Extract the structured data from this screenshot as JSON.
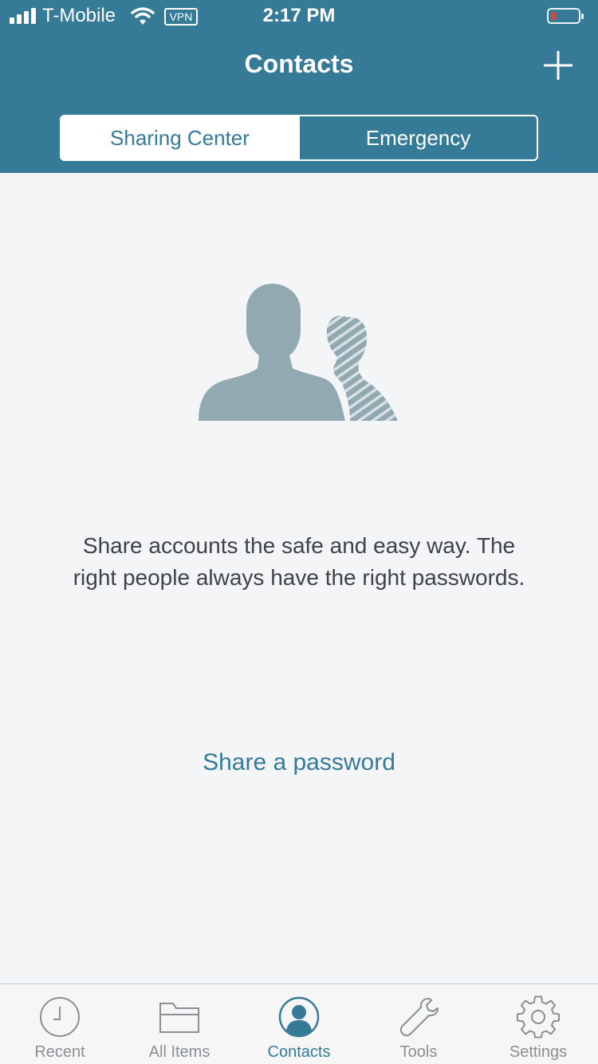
{
  "status_bar": {
    "carrier": "T-Mobile",
    "vpn": "VPN",
    "time": "2:17 PM",
    "battery_level": 0.15
  },
  "nav": {
    "title": "Contacts",
    "add_icon": "plus-icon"
  },
  "segments": [
    {
      "label": "Sharing Center",
      "selected": true
    },
    {
      "label": "Emergency",
      "selected": false
    }
  ],
  "empty_state": {
    "illustration": "people-silhouette-icon",
    "message": "Share accounts the safe and easy way. The right people always have the right passwords.",
    "action_label": "Share a password"
  },
  "tabbar": {
    "items": [
      {
        "label": "Recent",
        "icon": "clock-icon",
        "active": false
      },
      {
        "label": "All Items",
        "icon": "folder-icon",
        "active": false
      },
      {
        "label": "Contacts",
        "icon": "person-circle-icon",
        "active": true
      },
      {
        "label": "Tools",
        "icon": "wrench-icon",
        "active": false
      },
      {
        "label": "Settings",
        "icon": "gear-icon",
        "active": false
      }
    ]
  },
  "colors": {
    "brand": "#357b97",
    "background": "#f4f5f7",
    "illustration": "#93a9b1",
    "tab_inactive": "#8a8f94"
  }
}
